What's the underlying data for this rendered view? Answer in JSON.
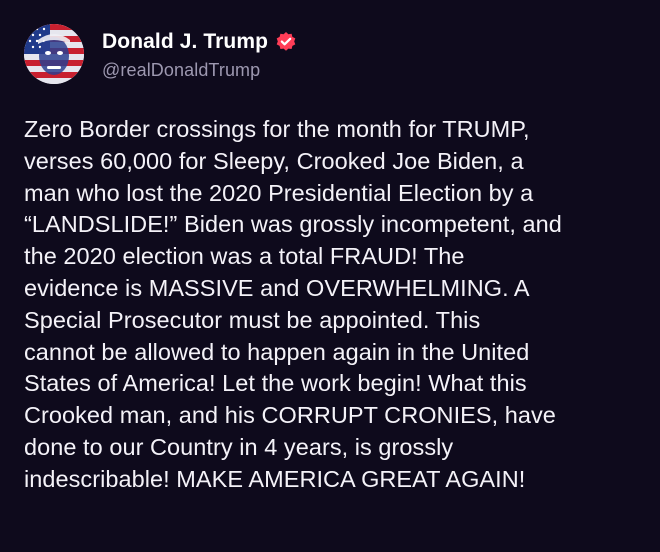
{
  "post": {
    "author": {
      "display_name": "Donald J. Trump",
      "handle": "@realDonaldTrump",
      "verified": true,
      "avatar_icon": "flag-portrait-avatar"
    },
    "body": "Zero Border crossings for the month for TRUMP,\nverses 60,000 for Sleepy, Crooked Joe Biden, a\nman who lost the 2020 Presidential Election by a\n“LANDSLIDE!” Biden was grossly incompetent, and\nthe 2020 election was a total FRAUD! The\nevidence is MASSIVE and OVERWHELMING. A\nSpecial Prosecutor must be appointed. This\ncannot be allowed to happen again in the United\nStates of America! Let the work begin! What this\nCrooked man, and his CORRUPT CRONIES, have\ndone to our Country in 4 years, is grossly\nindescribable! MAKE AMERICA GREAT AGAIN!"
  },
  "colors": {
    "background": "#0e0a1c",
    "text": "#f4f2f8",
    "handle": "#9d98b0",
    "verified_badge": "#ff3d57"
  }
}
